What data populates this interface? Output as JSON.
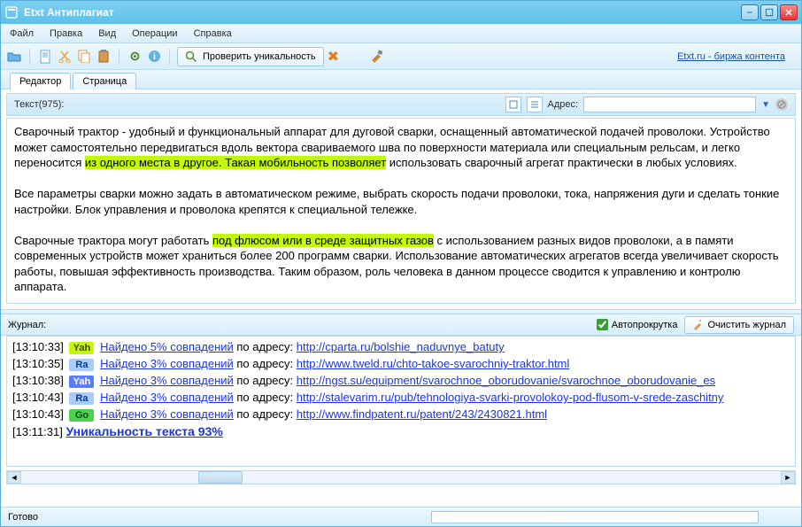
{
  "title": "Etxt Антиплагиат",
  "menu": {
    "file": "Файл",
    "edit": "Правка",
    "view": "Вид",
    "ops": "Операции",
    "help": "Справка"
  },
  "toolbar": {
    "check_label": "Проверить уникальность",
    "ext_link": "Etxt.ru - биржа контента"
  },
  "tabs": {
    "editor": "Редактор",
    "page": "Страница"
  },
  "infobar": {
    "text_label": "Текст(975):",
    "addr_label": "Адрес:",
    "addr_value": ""
  },
  "editor": {
    "p1a": "Сварочный трактор - удобный и функциональный аппарат для дуговой сварки, оснащенный автоматической подачей проволоки. Устройство может самостоятельно передвигаться вдоль вектора свариваемого шва по поверхности материала или специальным рельсам, и легко переносится ",
    "p1hl": "из одного места в другое. Такая мобильность позволяет",
    "p1b": " использовать сварочный агрегат практически в любых условиях.",
    "p2": "Все параметры сварки можно задать в автоматическом режиме, выбрать скорость подачи проволоки, тока, напряжения дуги и сделать тонкие настройки. Блок управления и проволока крепятся к специальной тележке.",
    "p3a": "Сварочные трактора могут работать ",
    "p3hl": "под флюсом или в среде защитных газов",
    "p3b": " с использованием разных видов проволоки, а в памяти современных устройств может храниться более 200 программ сварки. Использование автоматических агрегатов всегда увеличивает скорость работы, повышая эффективность производства. Таким образом, роль человека в данном процессе сводится к управлению и контролю аппарата."
  },
  "journal": {
    "head": "Журнал:",
    "autoscroll": "Автопрокрутка",
    "clear": "Очистить журнал",
    "addr_word": " по адресу: ",
    "lines": [
      {
        "ts": "[13:10:33]",
        "badge": "Yah",
        "bclass": "b-yah",
        "match": "Найдено 5% совпадений",
        "url": "http://cparta.ru/bolshie_naduvnye_batuty"
      },
      {
        "ts": "[13:10:35]",
        "badge": "Ra",
        "bclass": "b-ra",
        "match": "Найдено 3% совпадений",
        "url": "http://www.tweld.ru/chto-takoe-svarochniy-traktor.html"
      },
      {
        "ts": "[13:10:38]",
        "badge": "Yah",
        "bclass": "b-ya2",
        "match": "Найдено 3% совпадений",
        "url": "http://ngst.su/equipment/svarochnoe_oborudovanie/svarochnoe_oborudovanie_es"
      },
      {
        "ts": "[13:10:43]",
        "badge": "Ra",
        "bclass": "b-ra",
        "match": "Найдено 3% совпадений",
        "url": "http://stalevarim.ru/pub/tehnologiya-svarki-provolokoy-pod-flusom-v-srede-zaschitny"
      },
      {
        "ts": "[13:10:43]",
        "badge": "Go",
        "bclass": "b-go",
        "match": "Найдено 3% совпадений",
        "url": "http://www.findpatent.ru/patent/243/2430821.html"
      }
    ],
    "result_ts": "[13:11:31]",
    "result": "Уникальность текста 93%"
  },
  "status": "Готово"
}
